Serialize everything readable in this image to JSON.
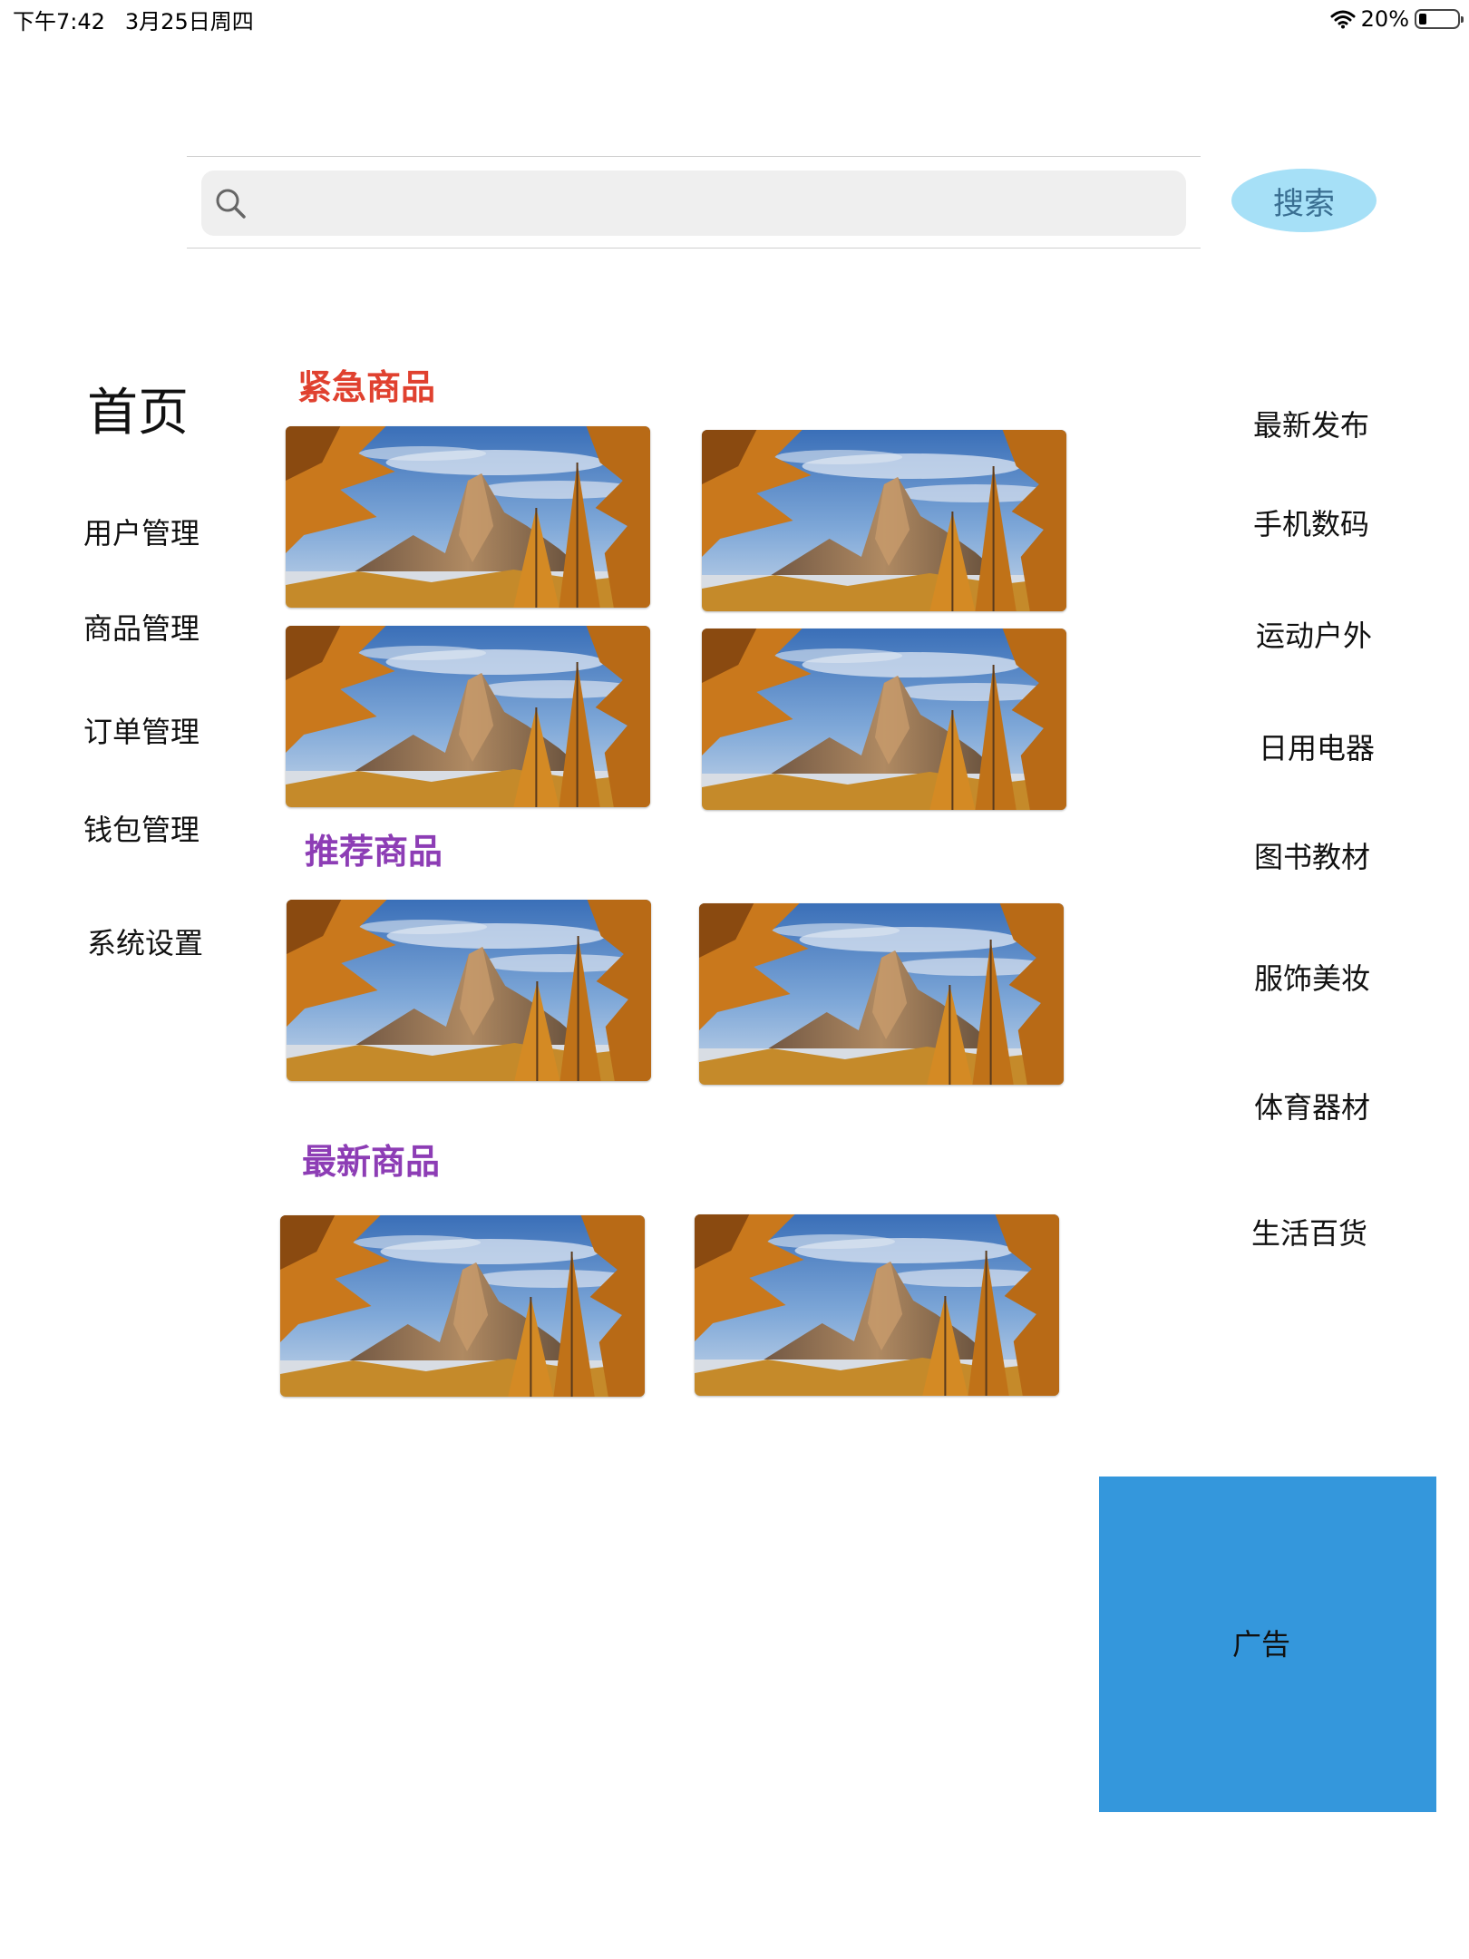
{
  "status_bar": {
    "time": "下午7:42",
    "date": "3月25日周四",
    "battery_percent": "20%",
    "battery_level": 0.2,
    "wifi_icon": "wifi-icon",
    "battery_icon": "battery-icon"
  },
  "search": {
    "value": "",
    "placeholder": "",
    "button_label": "搜索",
    "icon": "search-icon",
    "button_color": "#a6e0f7"
  },
  "nav": {
    "home": "首页",
    "items": [
      {
        "label": "用户管理"
      },
      {
        "label": "商品管理"
      },
      {
        "label": "订单管理"
      },
      {
        "label": "钱包管理"
      },
      {
        "label": "系统设置"
      }
    ]
  },
  "sections": [
    {
      "title": "紧急商品",
      "color": "#e0412f",
      "image_count": 4
    },
    {
      "title": "推荐商品",
      "color": "#8d3db5",
      "image_count": 2
    },
    {
      "title": "最新商品",
      "color": "#8d3db5",
      "image_count": 2
    }
  ],
  "product_image": "mountain-autumn-landscape-image",
  "categories": [
    {
      "label": "最新发布"
    },
    {
      "label": "手机数码"
    },
    {
      "label": "运动户外"
    },
    {
      "label": "日用电器"
    },
    {
      "label": "图书教材"
    },
    {
      "label": "服饰美妆"
    },
    {
      "label": "体育器材"
    },
    {
      "label": "生活百货"
    }
  ],
  "ad": {
    "label": "广告",
    "color": "#3497dc"
  }
}
